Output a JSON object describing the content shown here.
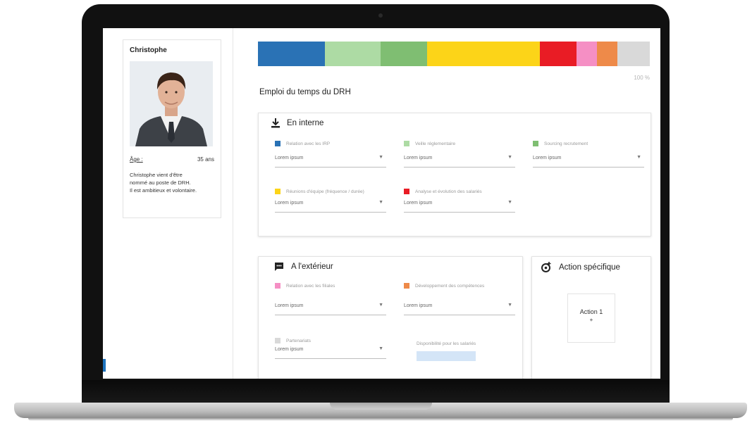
{
  "profile": {
    "name": "Christophe",
    "age_label": "Âge :",
    "age_value": "35 ans",
    "description": [
      "Christophe vient d'être",
      "nommé au poste de DRH.",
      "Il est ambitieux et volontaire."
    ]
  },
  "time_bar": {
    "percent_label": "100 %",
    "segments": [
      {
        "color": "#2a72b5",
        "fraction": 0.171
      },
      {
        "color": "#addba4",
        "fraction": 0.142
      },
      {
        "color": "#7fbe72",
        "fraction": 0.119
      },
      {
        "color": "#fcd418",
        "fraction": 0.288
      },
      {
        "color": "#e91c25",
        "fraction": 0.093
      },
      {
        "color": "#f58fc4",
        "fraction": 0.052
      },
      {
        "color": "#ee8a49",
        "fraction": 0.052
      },
      {
        "color": "#d9d9d9",
        "fraction": 0.083
      }
    ]
  },
  "schedule_title": "Emploi du temps du DRH",
  "internal": {
    "title": "En interne",
    "icon": "download-icon",
    "fields": [
      {
        "label": "Relation avec les IRP",
        "color": "#2a72b5",
        "value": "Lorem ipsum"
      },
      {
        "label": "Veille réglementaire",
        "color": "#addba4",
        "value": "Lorem ipsum"
      },
      {
        "label": "Sourcing recrutement",
        "color": "#7fbe72",
        "value": "Lorem ipsum"
      },
      {
        "label": "Réunions d'équipe (fréquence / durée)",
        "color": "#fcd418",
        "value": "Lorem ipsum"
      },
      {
        "label": "Analyse et évolution des salariés",
        "color": "#e91c25",
        "value": "Lorem ipsum"
      }
    ]
  },
  "external": {
    "title": "A l'extérieur",
    "icon": "chat-icon",
    "fields": [
      {
        "label": "Relation avec les filiales",
        "color": "#f58fc4",
        "value": "Lorem ipsum"
      },
      {
        "label": "Développement des compétences",
        "color": "#ee8a49",
        "value": "Lorem ipsum"
      },
      {
        "label": "Partenariats",
        "color": "#d9d9d9",
        "value": "Lorem ipsum"
      }
    ],
    "availability_label": "Disponibilité pour les salariés"
  },
  "specific": {
    "title": "Action spécifique",
    "icon": "target-add-icon",
    "action_label": "Action 1",
    "action_add": "+"
  }
}
